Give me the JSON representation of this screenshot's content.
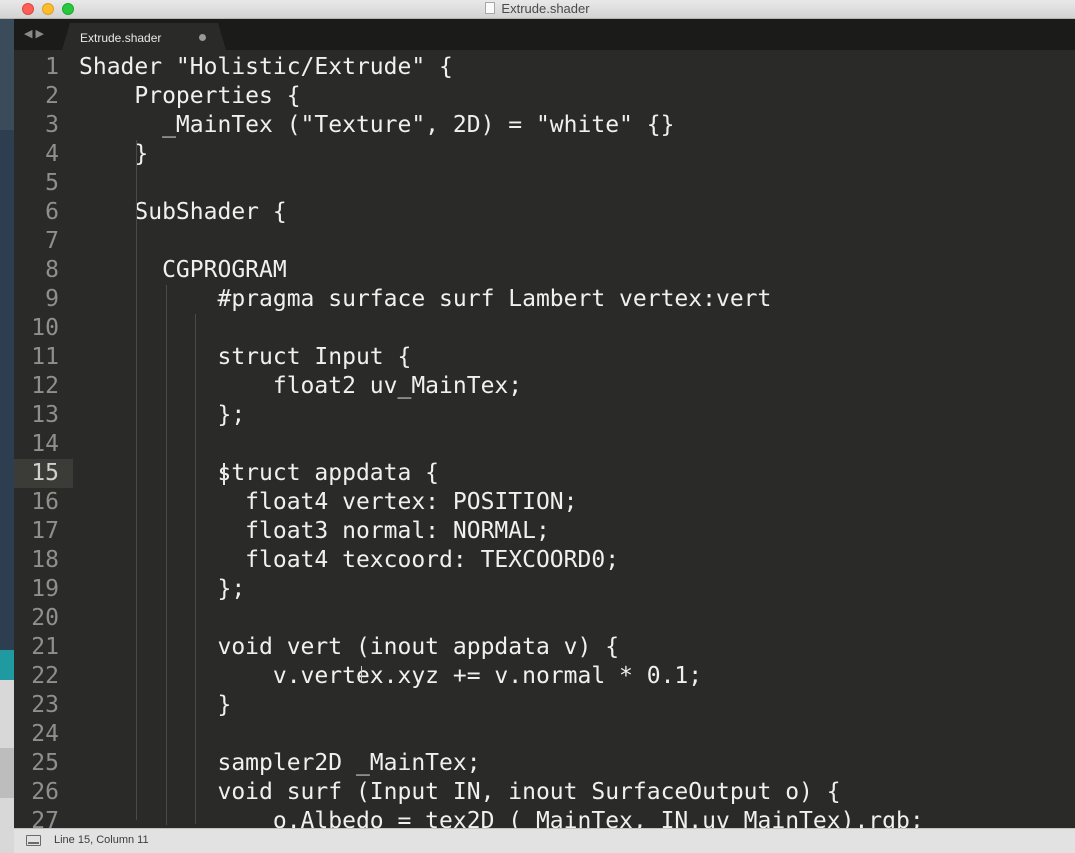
{
  "window": {
    "title": "Extrude.shader"
  },
  "tabs": [
    {
      "label": "Extrude.shader"
    }
  ],
  "editor": {
    "current_line": 15,
    "lines": [
      {
        "n": "1",
        "text": "Shader \"Holistic/Extrude\" {"
      },
      {
        "n": "2",
        "text": "    Properties {"
      },
      {
        "n": "3",
        "text": "      _MainTex (\"Texture\", 2D) = \"white\" {}"
      },
      {
        "n": "4",
        "text": "    }"
      },
      {
        "n": "5",
        "text": ""
      },
      {
        "n": "6",
        "text": "    SubShader {"
      },
      {
        "n": "7",
        "text": ""
      },
      {
        "n": "8",
        "text": "      CGPROGRAM"
      },
      {
        "n": "9",
        "text": "          #pragma surface surf Lambert vertex:vert"
      },
      {
        "n": "10",
        "text": ""
      },
      {
        "n": "11",
        "text": "          struct Input {"
      },
      {
        "n": "12",
        "text": "              float2 uv_MainTex;"
      },
      {
        "n": "13",
        "text": "          };"
      },
      {
        "n": "14",
        "text": ""
      },
      {
        "n": "15",
        "text": "          struct appdata {"
      },
      {
        "n": "16",
        "text": "            float4 vertex: POSITION;"
      },
      {
        "n": "17",
        "text": "            float3 normal: NORMAL;"
      },
      {
        "n": "18",
        "text": "            float4 texcoord: TEXCOORD0;"
      },
      {
        "n": "19",
        "text": "          };"
      },
      {
        "n": "20",
        "text": ""
      },
      {
        "n": "21",
        "text": "          void vert (inout appdata v) {"
      },
      {
        "n": "22",
        "text": "              v.vertex.xyz += v.normal * 0.1;"
      },
      {
        "n": "23",
        "text": "          }"
      },
      {
        "n": "24",
        "text": ""
      },
      {
        "n": "25",
        "text": "          sampler2D _MainTex;"
      },
      {
        "n": "26",
        "text": "          void surf (Input IN, inout SurfaceOutput o) {"
      },
      {
        "n": "27",
        "text": "              o.Albedo = tex2D (_MainTex, IN.uv_MainTex).rgb;"
      }
    ]
  },
  "statusbar": {
    "position": "Line 15, Column 11"
  }
}
